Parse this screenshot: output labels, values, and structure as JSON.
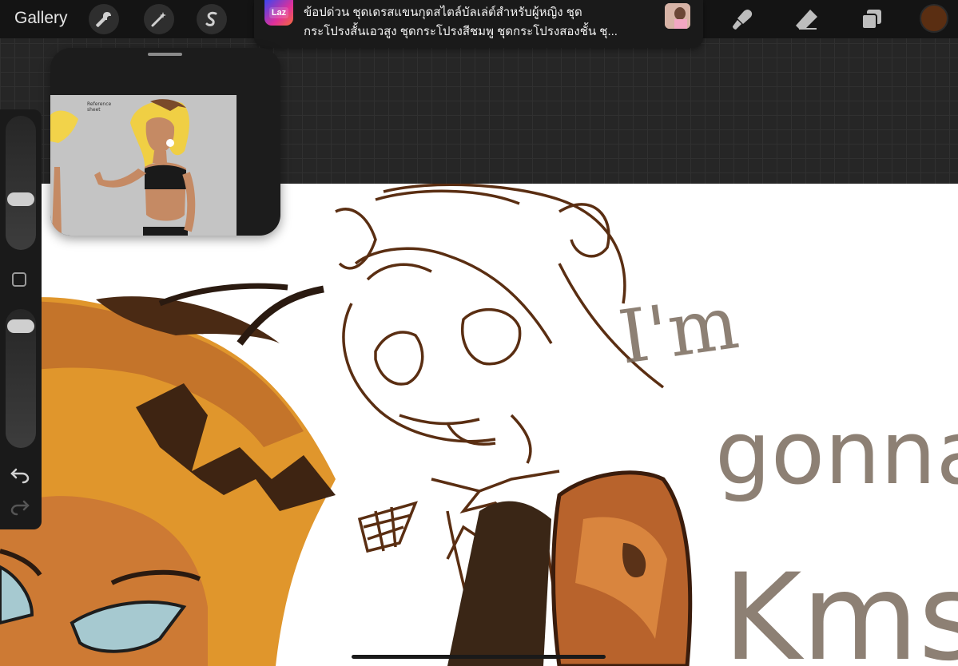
{
  "toolbar": {
    "gallery_label": "Gallery",
    "tools": [
      "wrench-icon",
      "magic-wand-icon",
      "selection-icon",
      "smudge-icon",
      "eraser-icon",
      "layers-icon"
    ],
    "current_color": "#5a2e12"
  },
  "notification": {
    "app_icon_label": "Laz",
    "line1": "ข้อปด่วน ชุดเดรสแขนกุดสไตล์บัลเล่ต์สำหรับผู้หญิง ชุด",
    "line2": "กระโปรงสั้นเอวสูง ชุดกระโปรงสีชมพู ชุดกระโปรงสองชั้น ชุ..."
  },
  "reference": {
    "caption_line1": "Reference",
    "caption_line2": "sheet"
  },
  "sidebar": {
    "brush_size_level": 0.35,
    "opacity_level": 0.95
  },
  "canvas": {
    "text_line1": "I'm",
    "text_line2": "gonna",
    "text_line3": "Kms"
  },
  "colors": {
    "toolbar_bg": "#141414",
    "canvas_bg": "#ffffff",
    "ink_brown": "#5a2e12",
    "hair_orange": "#d88a2a"
  }
}
